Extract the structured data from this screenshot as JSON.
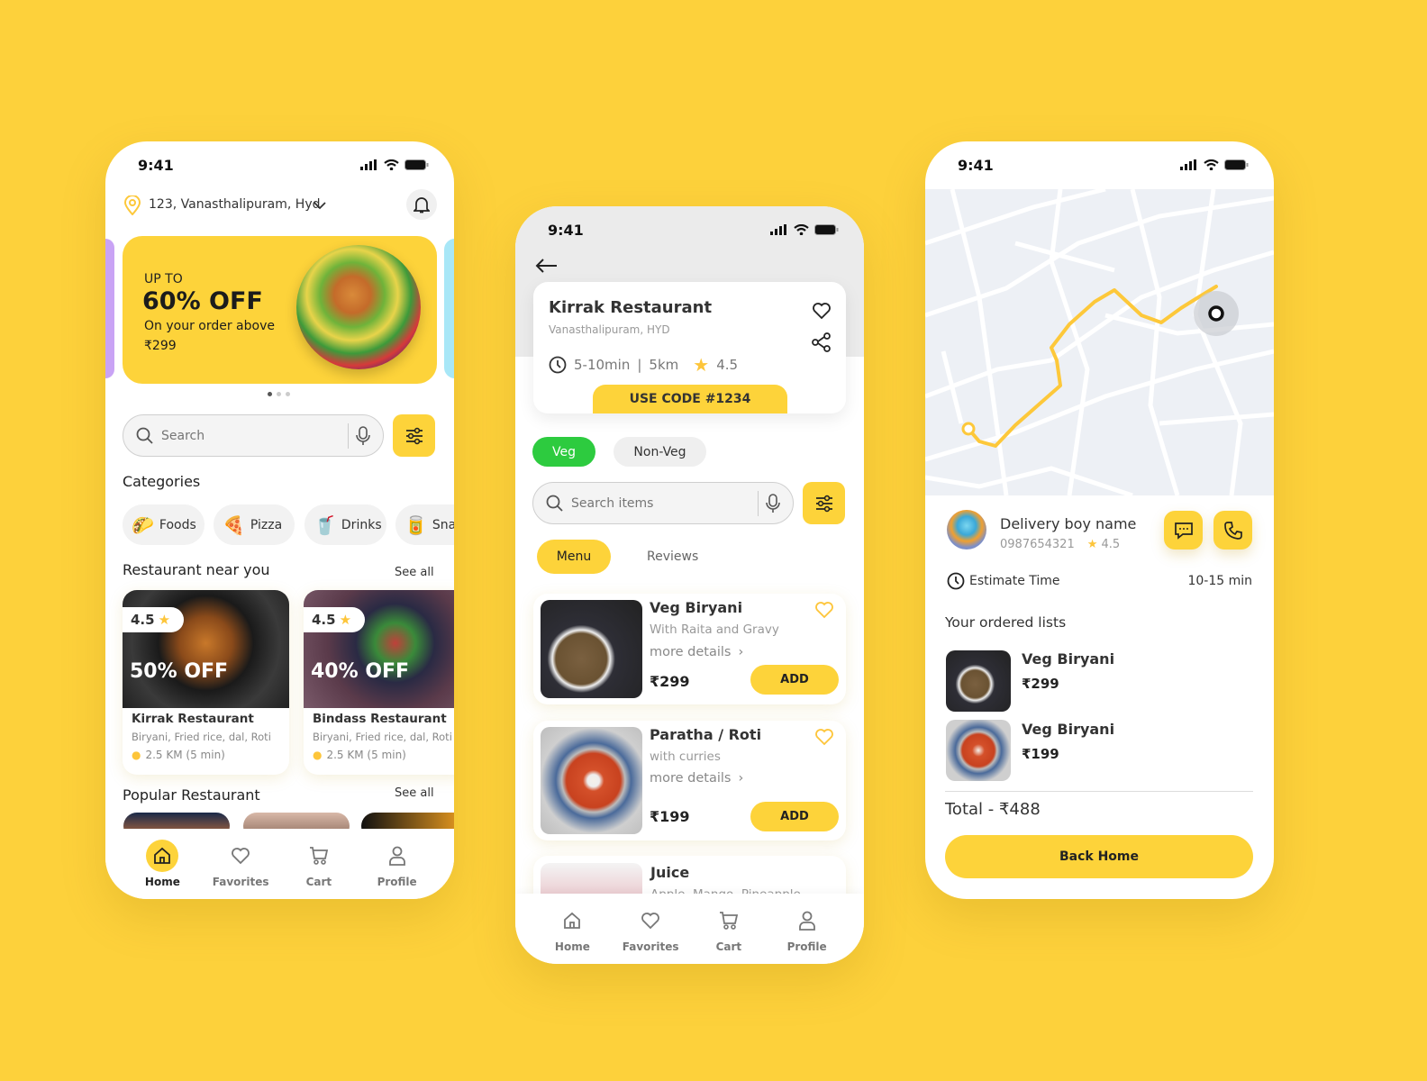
{
  "colors": {
    "background": "#FDD13B",
    "accent": "#FDD33A",
    "veg_green": "#2DCB3F"
  },
  "home": {
    "status_time": "9:41",
    "location": "123, Vanasthalipuram, Hyd",
    "banner": {
      "line1": "UP TO",
      "headline": "60% OFF",
      "line2": "On your order above",
      "amount": "₹299"
    },
    "search_placeholder": "Search",
    "categories_title": "Categories",
    "categories": [
      {
        "label": "Foods",
        "active": true
      },
      {
        "label": "Pizza"
      },
      {
        "label": "Drinks"
      },
      {
        "label": "Sna"
      }
    ],
    "near_title": "Restaurant near you",
    "near_see_all": "See all",
    "restaurants": [
      {
        "rating": "4.5",
        "offer": "50% OFF",
        "name": "Kirrak Restaurant",
        "cuisine": "Biryani, Fried rice, dal, Roti",
        "distance": "2.5 KM (5 min)"
      },
      {
        "rating": "4.5",
        "offer": "40% OFF",
        "name": "Bindass Restaurant",
        "cuisine": "Biryani, Fried rice, dal, Roti",
        "distance": "2.5 KM (5 min)"
      }
    ],
    "popular_title": "Popular Restaurant",
    "popular_see_all": "See all",
    "nav": [
      "Home",
      "Favorites",
      "Cart",
      "Profile"
    ]
  },
  "restaurant": {
    "status_time": "9:41",
    "name": "Kirrak Restaurant",
    "address": "Vanasthalipuram, HYD",
    "time": "5-10min",
    "separator": "|",
    "distance": "5km",
    "rating": "4.5",
    "code": "USE CODE #1234",
    "filters": [
      "Veg",
      "Non-Veg"
    ],
    "search_placeholder": "Search items",
    "tabs": [
      "Menu",
      "Reviews"
    ],
    "items": [
      {
        "name": "Veg Biryani",
        "desc": "With Raita and Gravy",
        "more": "more details",
        "price": "₹299",
        "add": "ADD"
      },
      {
        "name": "Paratha / Roti",
        "desc": "with curries",
        "more": "more details",
        "price": "₹199",
        "add": "ADD"
      },
      {
        "name": "Juice",
        "desc": "Apple, Mango, Pineapple"
      }
    ],
    "nav": [
      "Home",
      "Favorites",
      "Cart",
      "Profile"
    ]
  },
  "tracking": {
    "status_time": "9:41",
    "driver_name": "Delivery boy name",
    "driver_phone": "0987654321",
    "driver_rating": "4.5",
    "estimate_label": "Estimate Time",
    "estimate_value": "10-15 min",
    "ordered_title": "Your ordered lists",
    "orders": [
      {
        "name": "Veg Biryani",
        "price": "₹299"
      },
      {
        "name": "Veg Biryani",
        "price": "₹199"
      }
    ],
    "total": "Total - ₹488",
    "back_home": "Back Home"
  }
}
